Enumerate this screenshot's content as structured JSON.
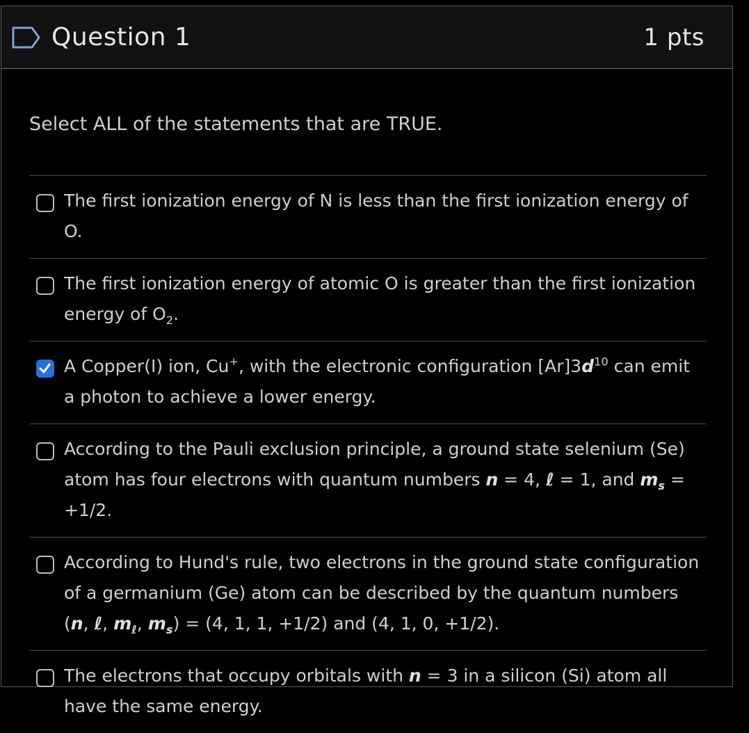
{
  "header": {
    "title": "Question 1",
    "points": "1 pts"
  },
  "prompt": "Select ALL of the statements that are TRUE.",
  "answers": [
    {
      "checked": false,
      "parts": [
        "The first ionization energy of N is less than the first ionization energy of O."
      ]
    },
    {
      "checked": false,
      "parts": [
        "The first ionization energy of atomic O is greater than the first ionization energy of O",
        "2",
        "."
      ]
    },
    {
      "checked": true,
      "parts": [
        "A Copper(I) ion, Cu",
        "+",
        ", with the electronic configuration [Ar]3",
        "d",
        "10",
        " can emit a photon to achieve a lower energy."
      ]
    },
    {
      "checked": false,
      "parts": [
        "According to the Pauli exclusion principle, a ground state selenium (Se) atom has four electrons with quantum numbers ",
        "n",
        " = 4, ",
        "ℓ",
        " = 1, and ",
        "m",
        "s",
        " = +1/2."
      ]
    },
    {
      "checked": false,
      "parts": [
        "According to Hund's rule, two electrons in the ground state configuration of a germanium (Ge) atom can be described by the quantum numbers (",
        "n",
        ", ",
        "ℓ",
        ", ",
        "m",
        "ℓ",
        ", ",
        "m",
        "s",
        ") = (4, 1, 1, +1/2) and (4, 1, 0, +1/2)."
      ]
    },
    {
      "checked": false,
      "parts": [
        "The electrons that occupy orbitals with ",
        "n",
        " = 3 in a silicon (Si) atom all have the same energy."
      ]
    }
  ],
  "colors": {
    "accent": "#2b6fd6",
    "background": "#000000",
    "header_bg": "#111111"
  }
}
